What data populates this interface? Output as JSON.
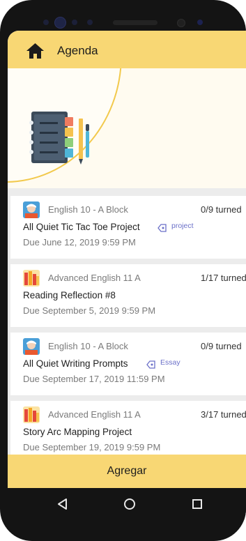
{
  "header": {
    "title": "Agenda",
    "home_icon": "home-icon"
  },
  "hero": {
    "illustration_icon": "notebook-icon"
  },
  "assignments": [
    {
      "course": "English 10 - A Block",
      "course_avatar": "teacher-avatar-icon",
      "turned_in": "0/9 turned",
      "title": "All Quiet Tic Tac Toe Project",
      "tag": "project",
      "due": "Due June 12, 2019 9:59 PM"
    },
    {
      "course": "Advanced English 11 A",
      "course_avatar": "books-avatar-icon",
      "turned_in": "1/17 turned",
      "title": "Reading Reflection #8",
      "tag": "",
      "due": "Due September 5, 2019 9:59 PM"
    },
    {
      "course": "English 10 - A Block",
      "course_avatar": "teacher-avatar-icon",
      "turned_in": "0/9 turned",
      "title": "All Quiet Writing Prompts",
      "tag": "Essay",
      "due": "Due September 17, 2019 11:59 PM"
    },
    {
      "course": "Advanced English 11 A",
      "course_avatar": "books-avatar-icon",
      "turned_in": "3/17 turned",
      "title": "Story Arc Mapping Project",
      "tag": "",
      "due": "Due September 19, 2019 9:59 PM"
    }
  ],
  "footer": {
    "add_label": "Agregar"
  },
  "navbar": {
    "back_icon": "back-triangle-icon",
    "home_icon": "home-circle-icon",
    "recents_icon": "recents-square-icon"
  },
  "colors": {
    "accent": "#f8d774",
    "tag": "#6a6fc8",
    "muted_text": "#7a7a7a"
  }
}
